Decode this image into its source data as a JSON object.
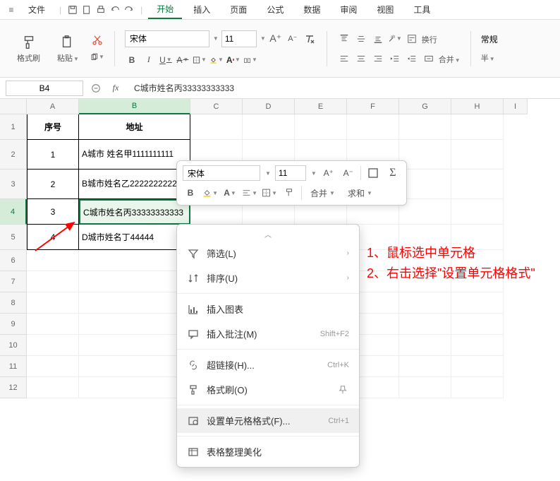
{
  "menubar": {
    "file": "文件",
    "items": [
      "开始",
      "插入",
      "页面",
      "公式",
      "数据",
      "审阅",
      "视图",
      "工具"
    ],
    "active_index": 0
  },
  "ribbon": {
    "format_painter": "格式刷",
    "paste": "粘贴",
    "font_name": "宋体",
    "font_size": "11",
    "wrap": "换行",
    "merge": "合并",
    "number_format": "常规",
    "currency": "半"
  },
  "namebox": "B4",
  "formula": "C城市姓名丙33333333333",
  "columns": [
    "A",
    "B",
    "C",
    "D",
    "E",
    "F",
    "G",
    "H",
    "I"
  ],
  "sel_col_index": 1,
  "rows_labels": [
    "1",
    "2",
    "3",
    "4",
    "5",
    "6",
    "7",
    "8",
    "9",
    "10",
    "11",
    "12"
  ],
  "sel_row_index": 3,
  "table": {
    "headers": [
      "序号",
      "地址"
    ],
    "rows": [
      {
        "num": "1",
        "addr": "A城市\n姓名甲1111111111"
      },
      {
        "num": "2",
        "addr": "B城市姓名乙2222222222"
      },
      {
        "num": "3",
        "addr": "C城市姓名丙33333333333"
      },
      {
        "num": "4",
        "addr": "D城市姓名丁44444"
      }
    ]
  },
  "mini": {
    "font_name": "宋体",
    "font_size": "11",
    "merge": "合并",
    "sum": "求和"
  },
  "ctx": {
    "filter": "筛选(L)",
    "sort": "排序(U)",
    "insert_chart": "插入图表",
    "insert_comment": "插入批注(M)",
    "insert_comment_sc": "Shift+F2",
    "hyperlink": "超链接(H)...",
    "hyperlink_sc": "Ctrl+K",
    "format_painter": "格式刷(O)",
    "cell_format": "设置单元格格式(F)...",
    "cell_format_sc": "Ctrl+1",
    "beautify": "表格整理美化"
  },
  "annotation": {
    "line1": "1、鼠标选中单元格",
    "line2": "2、右击选择\"设置单元格格式\""
  }
}
